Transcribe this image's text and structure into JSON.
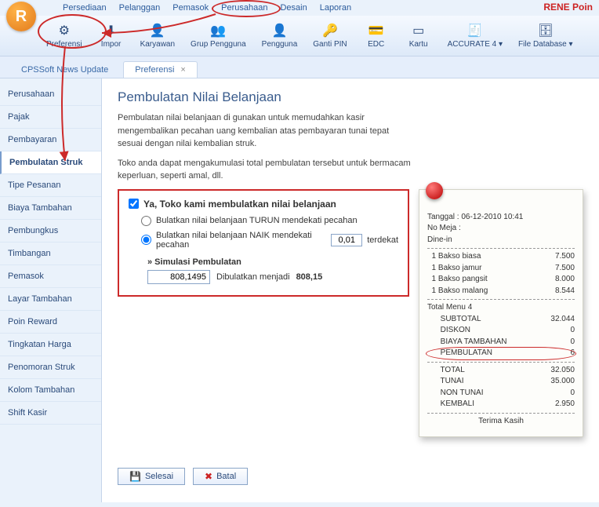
{
  "brand": "RENE Poin",
  "menubar": [
    "Persediaan",
    "Pelanggan",
    "Pemasok",
    "Perusahaan",
    "Desain",
    "Laporan"
  ],
  "toolbar": [
    {
      "label": "Preferensi",
      "icon": "⚙"
    },
    {
      "label": "Impor",
      "icon": "⬇"
    },
    {
      "label": "Karyawan",
      "icon": "👤"
    },
    {
      "label": "Grup Pengguna",
      "icon": "👥"
    },
    {
      "label": "Pengguna",
      "icon": "👤"
    },
    {
      "label": "Ganti PIN",
      "icon": "🔑"
    },
    {
      "label": "EDC",
      "icon": "💳"
    },
    {
      "label": "Kartu",
      "icon": "▭"
    },
    {
      "label": "ACCURATE 4 ▾",
      "icon": "🧾"
    },
    {
      "label": "File Database ▾",
      "icon": "🗄"
    }
  ],
  "tabs": [
    {
      "label": "CPSSoft News Update",
      "active": false
    },
    {
      "label": "Preferensi",
      "active": true
    }
  ],
  "sidebar": [
    "Perusahaan",
    "Pajak",
    "Pembayaran",
    "Pembulatan Struk",
    "Tipe Pesanan",
    "Biaya Tambahan",
    "Pembungkus",
    "Timbangan",
    "Pemasok",
    "Layar Tambahan",
    "Poin Reward",
    "Tingkatan Harga",
    "Penomoran Struk",
    "Kolom Tambahan",
    "Shift Kasir"
  ],
  "sidebar_selected": 3,
  "page": {
    "title": "Pembulatan Nilai Belanjaan",
    "desc1": "Pembulatan nilai belanjaan di gunakan untuk memudahkan kasir mengembalikan pecahan uang kembalian atas pembayaran tunai tepat sesuai dengan nilai kembalian struk.",
    "desc2": "Toko anda dapat mengakumulasi total pembulatan tersebut untuk bermacam keperluan, seperti amal, dll.",
    "check_label": "Ya, Toko kami membulatkan nilai belanjaan",
    "checked": true,
    "radio1": "Bulatkan nilai belanjaan TURUN mendekati pecahan",
    "radio2": "Bulatkan nilai belanjaan NAIK mendekati pecahan",
    "radio_selected": 2,
    "pecahan_value": "0,01",
    "terdekat": "terdekat",
    "sim_header": "» Simulasi Pembulatan",
    "sim_input": "808,1495",
    "sim_result_label": "Dibulatkan menjadi",
    "sim_result_value": "808,15"
  },
  "receipt": {
    "header": [
      "Tanggal : 06-12-2010 10:41",
      "No Meja :",
      "Dine-in"
    ],
    "items": [
      {
        "l": "  1 Bakso biasa",
        "r": "7.500"
      },
      {
        "l": "  1 Bakso jamur",
        "r": "7.500"
      },
      {
        "l": "  1 Bakso pangsit",
        "r": "8.000"
      },
      {
        "l": "  1 Bakso malang",
        "r": "8.544"
      }
    ],
    "subtotal_hdr": "Total Menu 4",
    "subs": [
      {
        "l": "      SUBTOTAL",
        "r": "32.044"
      },
      {
        "l": "      DISKON",
        "r": "0"
      },
      {
        "l": "      BIAYA TAMBAHAN",
        "r": "0"
      },
      {
        "l": "      PEMBULATAN",
        "r": "6",
        "hl": true
      }
    ],
    "totals": [
      {
        "l": "      TOTAL",
        "r": "32.050"
      },
      {
        "l": "      TUNAI",
        "r": "35.000"
      },
      {
        "l": "      NON TUNAI",
        "r": "0"
      },
      {
        "l": "      KEMBALI",
        "r": "2.950"
      }
    ],
    "thanks": "Terima Kasih"
  },
  "buttons": {
    "save": "Selesai",
    "cancel": "Batal"
  }
}
